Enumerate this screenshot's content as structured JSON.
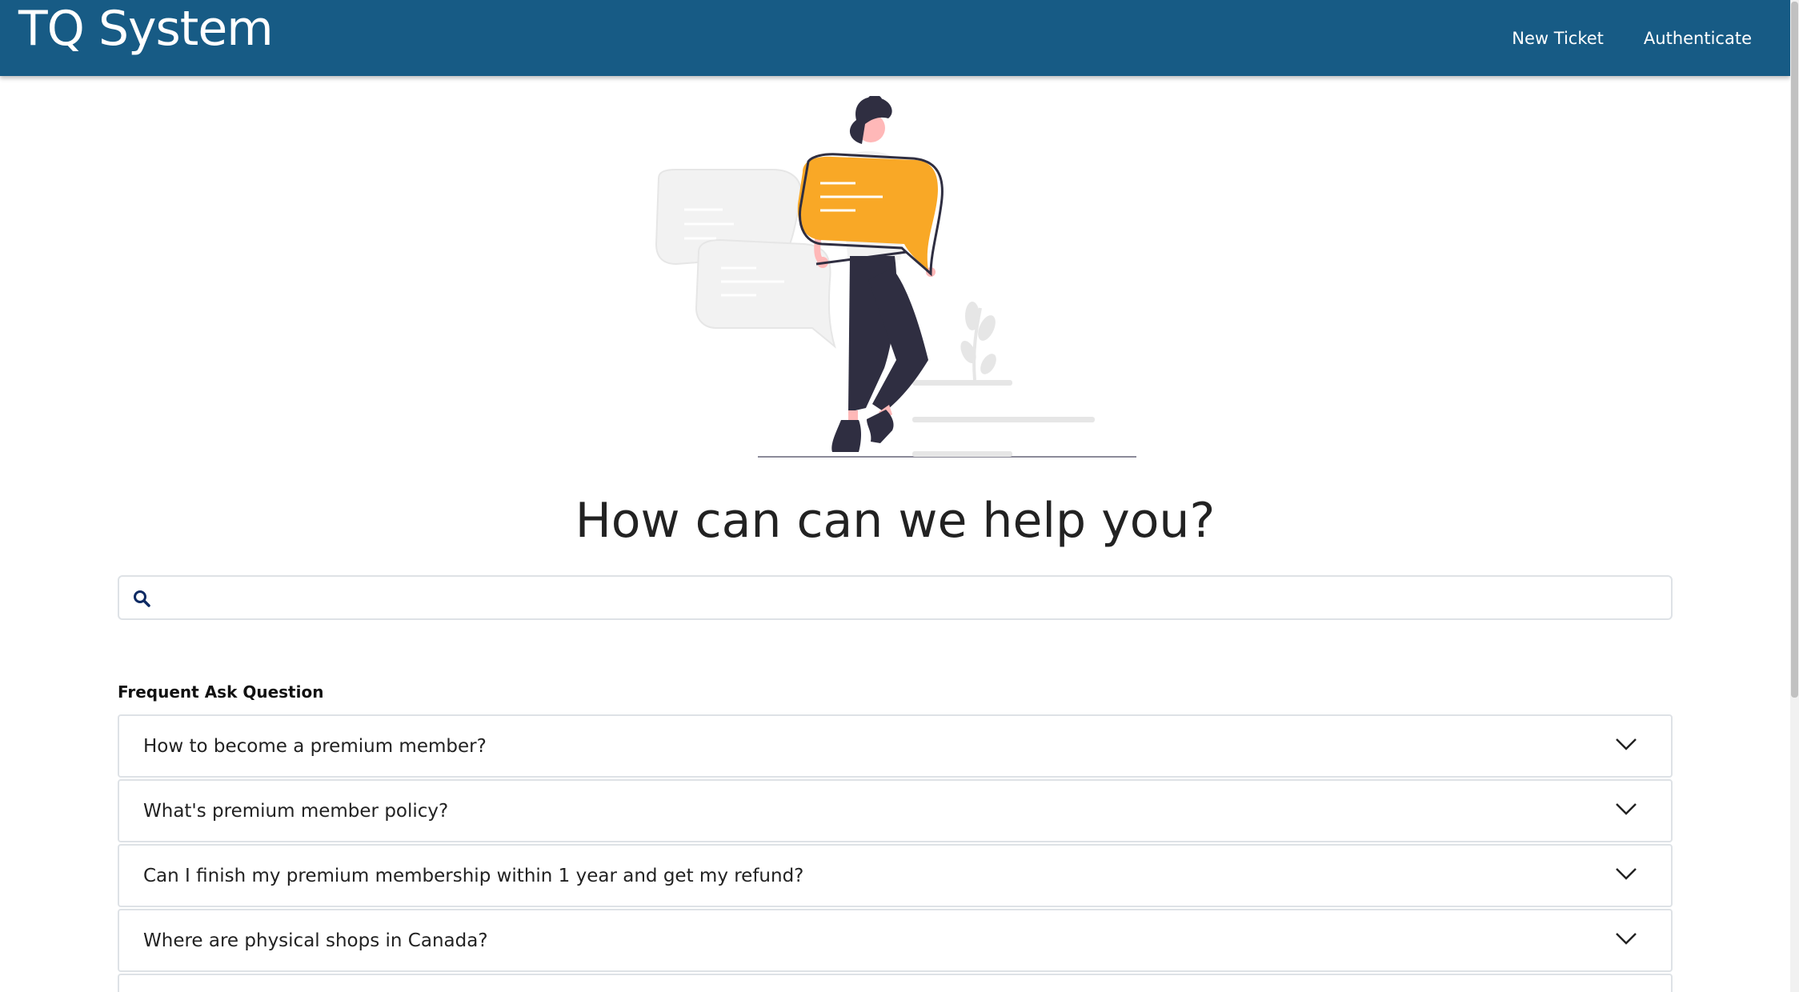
{
  "header": {
    "brand": "TQ System",
    "nav": [
      {
        "label": "New Ticket"
      },
      {
        "label": "Authenticate"
      }
    ]
  },
  "hero": {
    "illustration": "woman-holding-speech-bubble-illustration",
    "heading": "How can can we help you?"
  },
  "search": {
    "icon": "search-icon",
    "placeholder": "",
    "value": ""
  },
  "faq": {
    "title": "Frequent Ask Question",
    "items": [
      {
        "question": "How to become a premium member?",
        "icon": "chevron-down-icon"
      },
      {
        "question": "What's premium member policy?",
        "icon": "chevron-down-icon"
      },
      {
        "question": "Can I finish my premium membership within 1 year and get my refund?",
        "icon": "chevron-down-icon"
      },
      {
        "question": "Where are physical shops in Canada?",
        "icon": "chevron-down-icon"
      },
      {
        "question": "",
        "icon": "chevron-down-icon"
      }
    ]
  },
  "colors": {
    "navbar": "#175b85",
    "accent_bubble": "#f9a826",
    "figure_dark": "#2f2e41",
    "skin": "#ffb8b8",
    "border": "#dee2e6"
  }
}
